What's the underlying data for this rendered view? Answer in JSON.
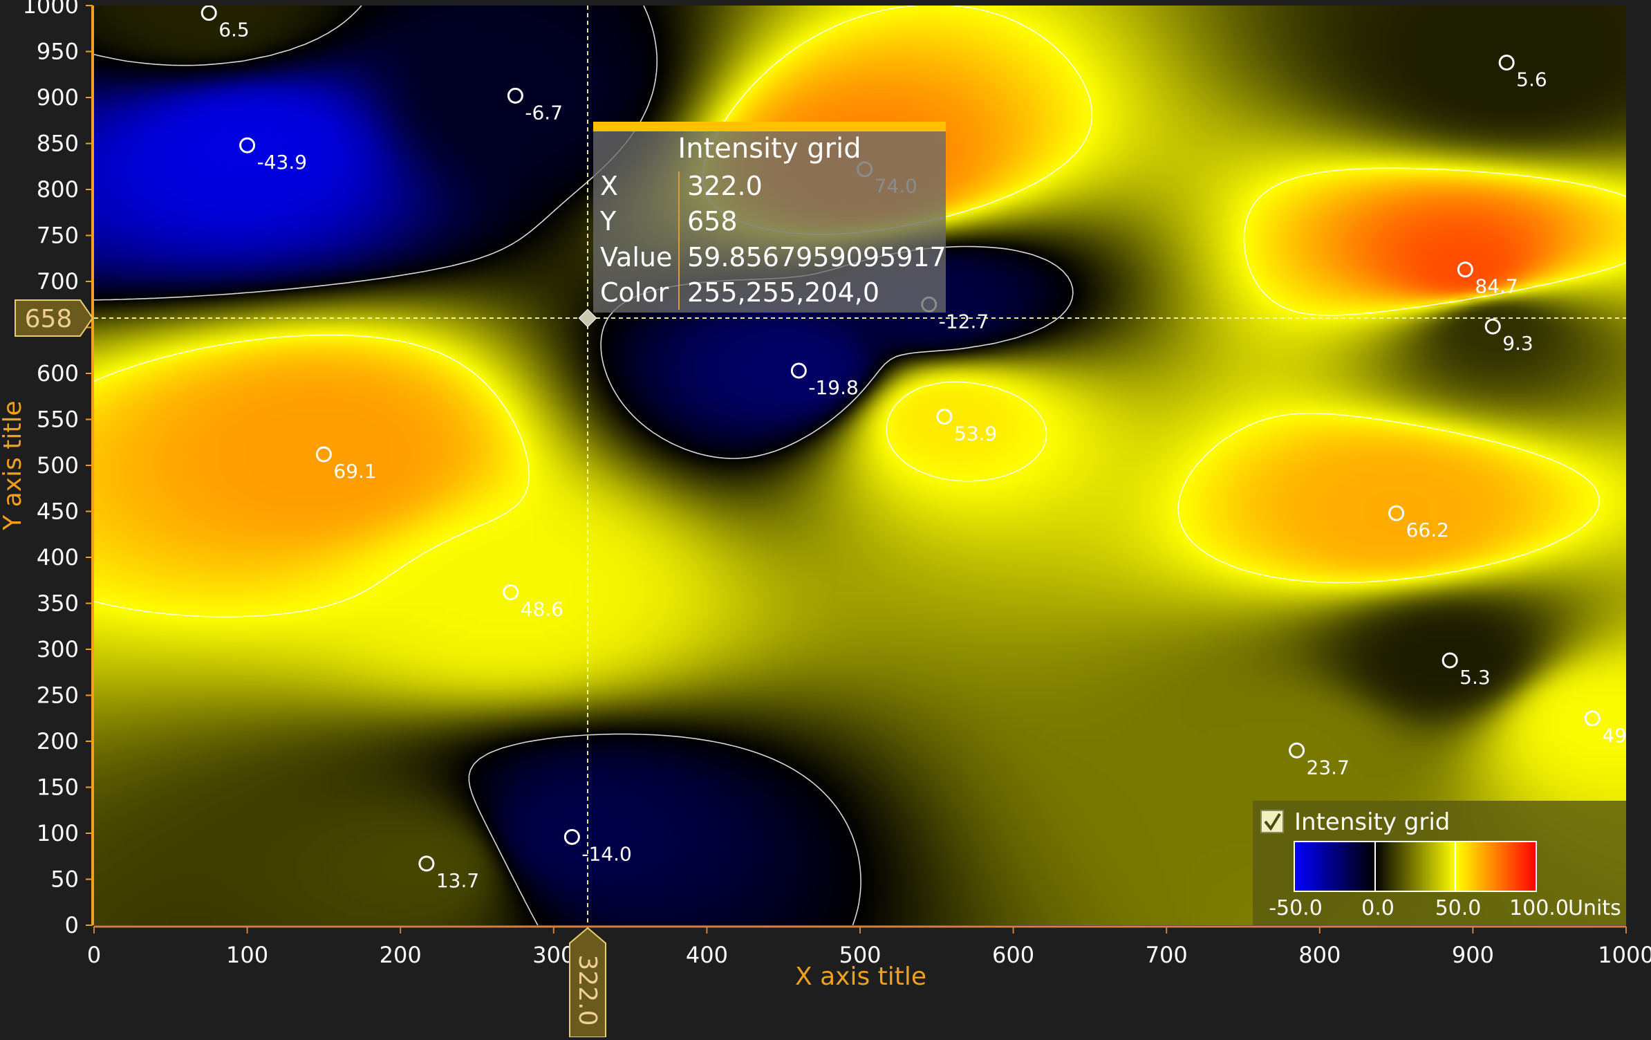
{
  "chart_data": {
    "type": "heatmap",
    "title": "",
    "xlabel": "X axis title",
    "ylabel": "Y axis title",
    "xlim": [
      0,
      1000
    ],
    "ylim": [
      0,
      1000
    ],
    "x_ticks": [
      0,
      100,
      200,
      300,
      400,
      500,
      600,
      700,
      800,
      900,
      1000
    ],
    "y_ticks": [
      0,
      50,
      100,
      150,
      200,
      250,
      300,
      350,
      400,
      450,
      500,
      550,
      600,
      650,
      700,
      750,
      800,
      850,
      900,
      950,
      1000
    ],
    "grid": false,
    "contour_levels": [
      0,
      50
    ],
    "palette": [
      {
        "value": -50,
        "color": "#0000ff"
      },
      {
        "value": 0,
        "color": "#000000"
      },
      {
        "value": 50,
        "color": "#ffff00"
      },
      {
        "value": 100,
        "color": "#ff0000"
      }
    ],
    "points": [
      {
        "x": 75,
        "y": 992,
        "value": 6.5,
        "label": "6.5"
      },
      {
        "x": 275,
        "y": 902,
        "value": -6.7,
        "label": "-6.7"
      },
      {
        "x": 100,
        "y": 848,
        "value": -43.9,
        "label": "-43.9"
      },
      {
        "x": 503,
        "y": 822,
        "value": 74.0,
        "label": "74.0"
      },
      {
        "x": 922,
        "y": 938,
        "value": 5.6,
        "label": "5.6"
      },
      {
        "x": 895,
        "y": 713,
        "value": 84.7,
        "label": "84.7"
      },
      {
        "x": 913,
        "y": 651,
        "value": 9.3,
        "label": "9.3"
      },
      {
        "x": 545,
        "y": 675,
        "value": -12.7,
        "label": "-12.7"
      },
      {
        "x": 460,
        "y": 603,
        "value": -19.8,
        "label": "-19.8"
      },
      {
        "x": 555,
        "y": 553,
        "value": 53.9,
        "label": "53.9"
      },
      {
        "x": 150,
        "y": 512,
        "value": 69.1,
        "label": "69.1"
      },
      {
        "x": 850,
        "y": 448,
        "value": 66.2,
        "label": "66.2"
      },
      {
        "x": 272,
        "y": 362,
        "value": 48.6,
        "label": "48.6"
      },
      {
        "x": 885,
        "y": 288,
        "value": 5.3,
        "label": "5.3"
      },
      {
        "x": 978,
        "y": 225,
        "value": 49,
        "label": "49"
      },
      {
        "x": 785,
        "y": 190,
        "value": 23.7,
        "label": "23.7"
      },
      {
        "x": 312,
        "y": 96,
        "value": -14.0,
        "label": "-14.0"
      },
      {
        "x": 217,
        "y": 67,
        "value": 13.7,
        "label": "13.7"
      }
    ],
    "cursor": {
      "x_label": "322.0",
      "y_label": "658"
    },
    "tooltip": {
      "title": "Intensity grid",
      "rows": [
        {
          "key": "X",
          "value": "322.0"
        },
        {
          "key": "Y",
          "value": "658"
        },
        {
          "key": "Value",
          "value": "59.8567959095917"
        },
        {
          "key": "Color",
          "value": "255,255,204,0"
        }
      ]
    },
    "legend": {
      "title": "Intensity grid",
      "checked": true,
      "placement": "bottom-right",
      "min_label": "-50.0",
      "zero_label": "0.0",
      "mid_label": "50.0",
      "max_label": "100.0",
      "units": "Units"
    }
  }
}
